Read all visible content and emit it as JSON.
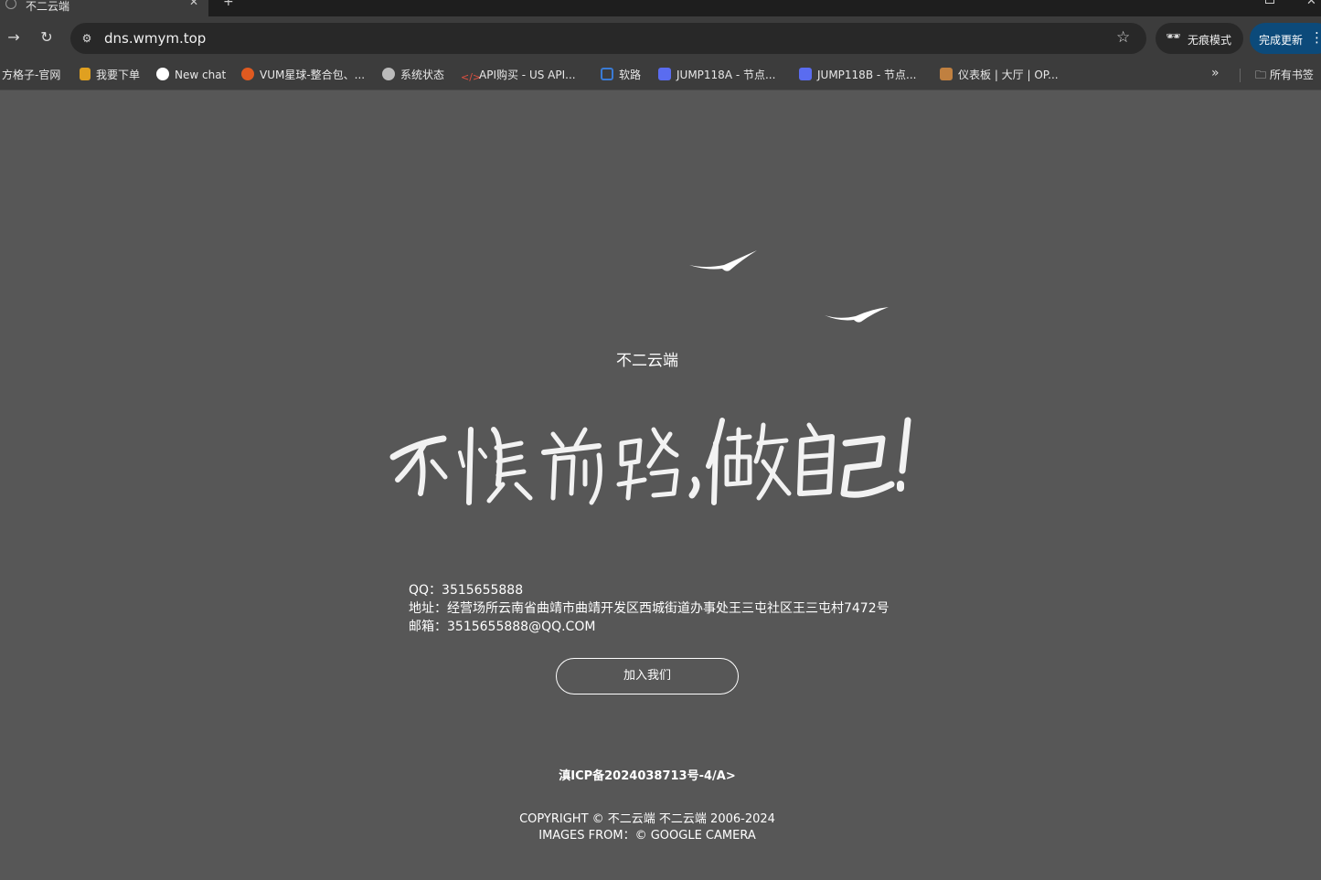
{
  "browser": {
    "tab_title": "不二云端",
    "tab_close": "✕",
    "new_tab": "+",
    "url": "dns.wmym.top",
    "incognito_label": "无痕模式",
    "update_label": "完成更新",
    "bookmarks": [
      {
        "label": "方格子-官网",
        "color": "#3a3a3a"
      },
      {
        "label": "我要下单",
        "color": "#e0a020"
      },
      {
        "label": "New chat",
        "color": "#ffffff"
      },
      {
        "label": "VUM星球-整合包、...",
        "color": "#e05a20"
      },
      {
        "label": "系统状态",
        "color": "#bbbbbb"
      },
      {
        "label": "API购买 - US API...",
        "color": "#e05040"
      },
      {
        "label": "软路",
        "color": "#3a7bd5"
      },
      {
        "label": "JUMP118A - 节点...",
        "color": "#5a6cf0"
      },
      {
        "label": "JUMP118B - 节点...",
        "color": "#5a6cf0"
      },
      {
        "label": "仪表板 | 大厅 | OP...",
        "color": "#c08040"
      }
    ],
    "bookmarks_folder": "所有书签"
  },
  "page": {
    "brand": "不二云端",
    "slogan_image_text": "不惧前路，做自己！",
    "info": {
      "qq": "QQ：3515655888",
      "address": "地址：经营场所云南省曲靖市曲靖开发区西城街道办事处王三屯社区王三屯村7472号",
      "email": "邮箱：3515655888@QQ.COM"
    },
    "join_button": "加入我们",
    "icp": "滇ICP备2024038713号-4/A>",
    "copyright": "COPYRIGHT © 不二云端 不二云端 2006-2024",
    "images_from": "IMAGES FROM：© GOOGLE CAMERA"
  }
}
